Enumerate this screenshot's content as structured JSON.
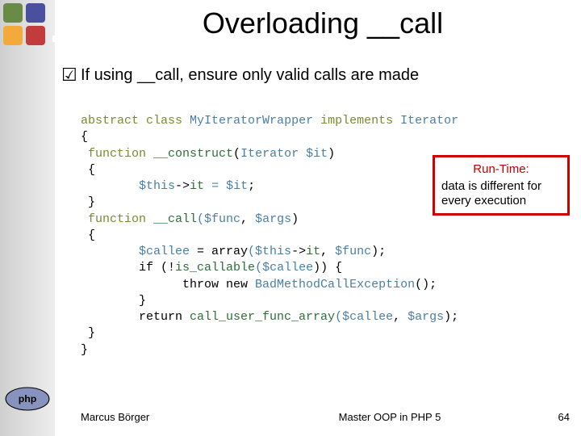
{
  "title": "Overloading __call",
  "bullet": "If using __call, ensure only valid calls are made",
  "code": {
    "l01a": "abstract class ",
    "l01b": "My",
    "l01c": "IteratorWrapper ",
    "l01d": "implements ",
    "l01e": "Iterator",
    "l02": "{",
    "l03a": " function ",
    "l03b": "__construct",
    "l03c": "(",
    "l03d": "Iterator ",
    "l03e": "$it",
    "l03f": ")",
    "l04": " {",
    "l05a": "        $this",
    "l05b": "->",
    "l05c": "it ",
    "l05d": "= $it",
    "l05e": ";",
    "l06": " }",
    "l07a": " function ",
    "l07b": "__call",
    "l07c": "($func",
    "l07d": ", ",
    "l07e": "$args",
    "l07f": ")",
    "l08": " {",
    "l09a": "        $callee ",
    "l09b": "= array",
    "l09c": "($this",
    "l09d": "->",
    "l09e": "it",
    "l09f": ", ",
    "l09g": "$func",
    "l09h": ");",
    "l10a": "        if (!",
    "l10b": "is_callable",
    "l10c": "($callee",
    "l10d": ")) {",
    "l11a": "              throw new ",
    "l11b": "BadMethodCallException",
    "l11c": "();",
    "l12": "        }",
    "l13a": "        return ",
    "l13b": "call_user_func_array",
    "l13c": "($callee",
    "l13d": ", ",
    "l13e": "$args",
    "l13f": ");",
    "l14": " }",
    "l15": "}"
  },
  "callout": {
    "title": "Run-Time:",
    "body": "data is different for every execution"
  },
  "footer": {
    "author": "Marcus Börger",
    "title": "Master OOP in PHP 5",
    "page": "64"
  }
}
